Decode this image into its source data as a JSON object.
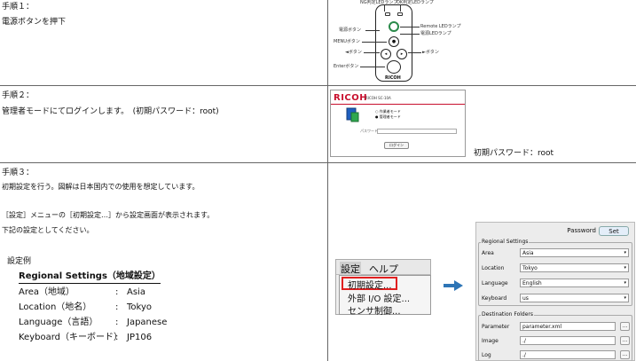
{
  "step1": {
    "heading": "手順１：",
    "desc": "電源ボタンを押下",
    "diagram": {
      "ng_led": "NG判定LEDランプ",
      "ok_led": "OK判定LEDランプ",
      "power_button": "電源ボタン",
      "menu_button": "MENUボタン",
      "left_button": "◄ボタン",
      "enter_button": "Enterボタン",
      "remote_led": "Remote LEDランプ",
      "power_led": "電源LEDランプ",
      "right_button": "►ボタン",
      "logo": "RICOH"
    }
  },
  "step2": {
    "heading": "手順２：",
    "desc": "管理者モードにてログインします。　(初期パスワード：root)",
    "login": {
      "logo": "RICOH",
      "model": "RICOH SC-10A",
      "radio1": "作業者モード",
      "radio2": "管理者モード",
      "password_label": "パスワード",
      "login_button": "ログイン"
    },
    "note": "初期パスワード：root"
  },
  "step3": {
    "heading": "手順３：",
    "desc": "初期設定を行う。図解は日本国内での使用を想定しています。",
    "menu_note": "［設定］メニューの［初期設定…］から設定画面が表示されます。",
    "settings_note": "下記の設定としてください。",
    "example_heading": "設定例",
    "regional_heading": "Regional Settings（地域設定）",
    "rows": [
      {
        "label": "Area（地域）",
        "colon": ":",
        "value": "Asia"
      },
      {
        "label": "Location（地名）",
        "colon": ":",
        "value": "Tokyo"
      },
      {
        "label": "Language（言語）",
        "colon": ":",
        "value": "Japanese"
      },
      {
        "label": "Keyboard（キーボード）",
        "colon": ":",
        "value": "JP106"
      }
    ],
    "menu": {
      "menu_settings": "設定",
      "menu_help": "ヘルプ",
      "item1": "初期設定...",
      "item2": "外部 I/O 設定...",
      "item3": "センサ制御..."
    },
    "panel": {
      "password_label": "Password",
      "set_button": "Set",
      "regional_group": "Regional Settings",
      "area_label": "Area",
      "area_value": "Asia",
      "location_label": "Location",
      "location_value": "Tokyo",
      "language_label": "Language",
      "language_value": "English",
      "keyboard_label": "Keyboard",
      "keyboard_value": "us",
      "dest_group": "Destination Folders",
      "param_label": "Parameter",
      "param_value": "parameter.xml",
      "image_label": "Image",
      "image_value": "./",
      "log_label": "Log",
      "log_value": "./",
      "browse": "..."
    }
  },
  "colors": {
    "ricoh_red": "#c8102e",
    "highlight_red": "#e02020",
    "arrow_blue": "#2e75b6"
  }
}
